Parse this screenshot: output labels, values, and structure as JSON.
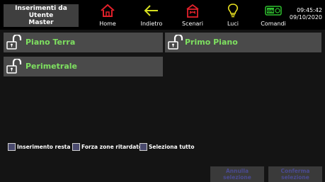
{
  "header": {
    "title_line1": "Inserimenti da Utente",
    "title_line2": "Master",
    "nav": [
      {
        "label": "Home",
        "icon": "home-icon",
        "color": "#e0202a"
      },
      {
        "label": "Indietro",
        "icon": "back-arrow-icon",
        "color": "#d6e020"
      },
      {
        "label": "Scenari",
        "icon": "scenes-icon",
        "color": "#e0202a"
      },
      {
        "label": "Luci",
        "icon": "lightbulb-icon",
        "color": "#e8e020"
      },
      {
        "label": "Comandi",
        "icon": "toggle-switch-icon",
        "color": "#2ec02e",
        "badge": "ON"
      }
    ],
    "time": "09:45:42",
    "date": "09/10/2020"
  },
  "zones": [
    {
      "name": "Piano Terra"
    },
    {
      "name": "Primo Piano"
    },
    {
      "name": "Perimetrale"
    }
  ],
  "options": [
    {
      "label": "Inserimento resta",
      "checked": false
    },
    {
      "label": "Forza zone ritardate",
      "checked": false
    },
    {
      "label": "Seleziona tutto",
      "checked": false
    }
  ],
  "buttons": {
    "annulla_line1": "Annulla",
    "annulla_line2": "selezione",
    "conferma_line1": "Conferma",
    "conferma_line2": "selezione"
  },
  "colors": {
    "zone_text": "#7ee060",
    "accent_red": "#e0202a",
    "disabled_text": "#4a4a90"
  }
}
